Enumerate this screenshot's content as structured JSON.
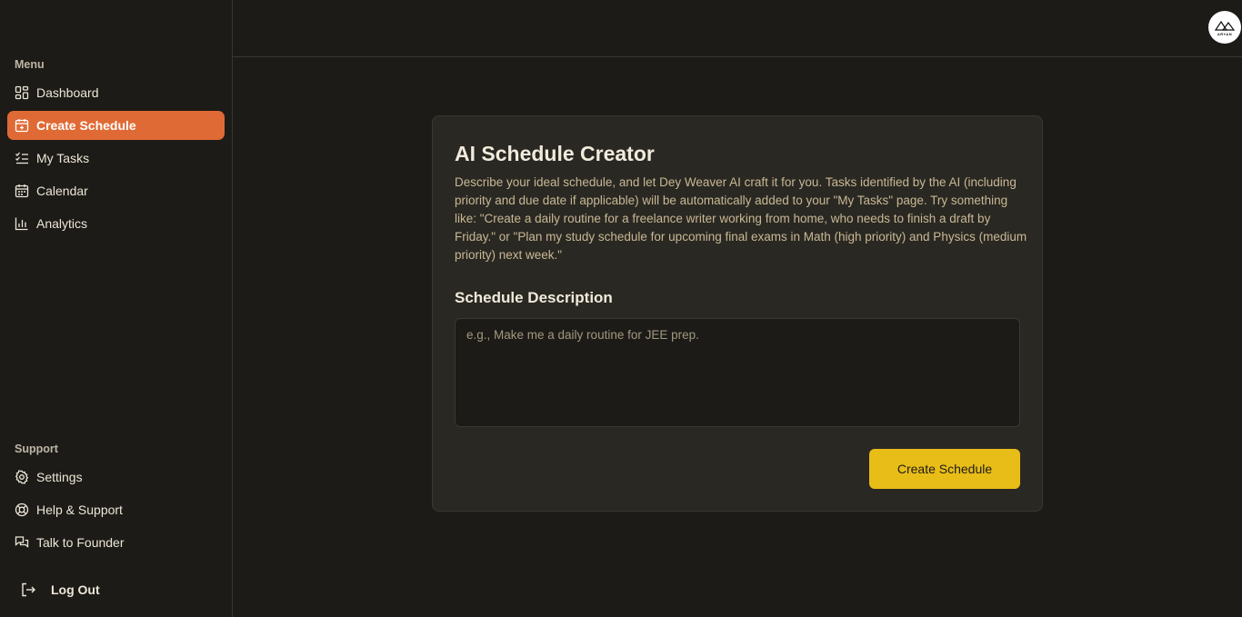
{
  "sidebar": {
    "menu_label": "Menu",
    "items": [
      {
        "label": "Dashboard",
        "icon": "dashboard-icon"
      },
      {
        "label": "Create Schedule",
        "icon": "calendar-plus-icon",
        "active": true
      },
      {
        "label": "My Tasks",
        "icon": "list-checks-icon"
      },
      {
        "label": "Calendar",
        "icon": "calendar-icon"
      },
      {
        "label": "Analytics",
        "icon": "bar-chart-icon"
      }
    ],
    "support_label": "Support",
    "support_items": [
      {
        "label": "Settings",
        "icon": "gear-icon"
      },
      {
        "label": "Help & Support",
        "icon": "lifebuoy-icon"
      },
      {
        "label": "Talk to Founder",
        "icon": "chat-icon"
      }
    ],
    "logout_label": "Log Out"
  },
  "header": {
    "avatar_text": "ARYAN"
  },
  "card": {
    "title": "AI Schedule Creator",
    "description": "Describe your ideal schedule, and let Dey Weaver AI craft it for you. Tasks identified by the AI (including priority and due date if applicable) will be automatically added to your \"My Tasks\" page. Try something like: \"Create a daily routine for a freelance writer working from home, who needs to finish a draft by Friday.\" or \"Plan my study schedule for upcoming final exams in Math (high priority) and Physics (medium priority) next week.\"",
    "field_label": "Schedule Description",
    "placeholder": "e.g., Make me a daily routine for JEE prep.",
    "value": "",
    "button_label": "Create Schedule"
  },
  "colors": {
    "accent_active": "#e06a35",
    "primary_button": "#e9bd18",
    "background": "#1d1b17",
    "card_background": "#2a2822"
  }
}
